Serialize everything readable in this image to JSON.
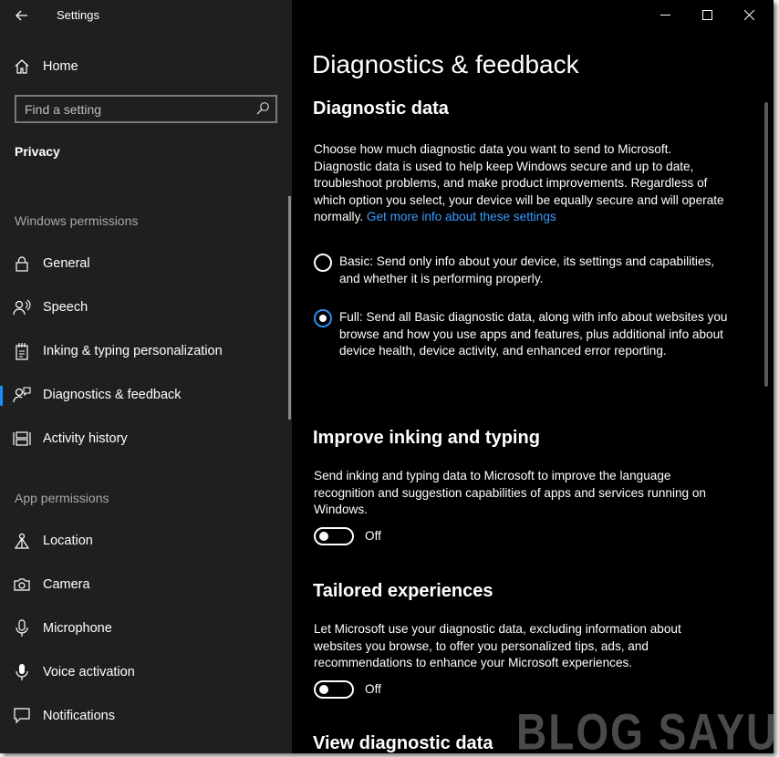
{
  "window": {
    "app_title": "Settings"
  },
  "sidebar": {
    "home_label": "Home",
    "search_placeholder": "Find a setting",
    "section": "Privacy",
    "windows_permissions_title": "Windows permissions",
    "windows_permissions": [
      {
        "label": "General",
        "icon": "lock-icon"
      },
      {
        "label": "Speech",
        "icon": "speech-icon"
      },
      {
        "label": "Inking & typing personalization",
        "icon": "inking-icon"
      },
      {
        "label": "Diagnostics & feedback",
        "icon": "feedback-icon",
        "active": true
      },
      {
        "label": "Activity history",
        "icon": "activity-icon"
      }
    ],
    "app_permissions_title": "App permissions",
    "app_permissions": [
      {
        "label": "Location",
        "icon": "location-icon"
      },
      {
        "label": "Camera",
        "icon": "camera-icon"
      },
      {
        "label": "Microphone",
        "icon": "microphone-icon"
      },
      {
        "label": "Voice activation",
        "icon": "voice-activation-icon"
      },
      {
        "label": "Notifications",
        "icon": "notifications-icon"
      }
    ]
  },
  "main": {
    "page_title": "Diagnostics & feedback",
    "diagnostic_data": {
      "heading": "Diagnostic data",
      "description": "Choose how much diagnostic data you want to send to Microsoft. Diagnostic data is used to help keep Windows secure and up to date, troubleshoot problems, and make product improvements. Regardless of which option you select, your device will be equally secure and will operate normally.",
      "link": "Get more info about these settings",
      "options": [
        {
          "label": "Basic: Send only info about your device, its settings and capabilities, and whether it is performing properly.",
          "selected": false
        },
        {
          "label": "Full: Send all Basic diagnostic data, along with info about websites you browse and how you use apps and features, plus additional info about device health, device activity, and enhanced error reporting.",
          "selected": true
        }
      ]
    },
    "inking": {
      "heading": "Improve inking and typing",
      "description": "Send inking and typing data to Microsoft to improve the language recognition and suggestion capabilities of apps and services running on Windows.",
      "toggle_state": "Off"
    },
    "tailored": {
      "heading": "Tailored experiences",
      "description": "Let Microsoft use your diagnostic data, excluding information about websites you browse, to offer you personalized tips, ads, and recommendations to enhance your Microsoft experiences.",
      "toggle_state": "Off"
    },
    "view_heading": "View diagnostic data"
  },
  "watermark": "BLOG SAYUGI",
  "colors": {
    "sidebar_bg": "#1f1f1f",
    "main_bg": "#000000",
    "accent": "#1a8cff",
    "link": "#3a9bff"
  }
}
